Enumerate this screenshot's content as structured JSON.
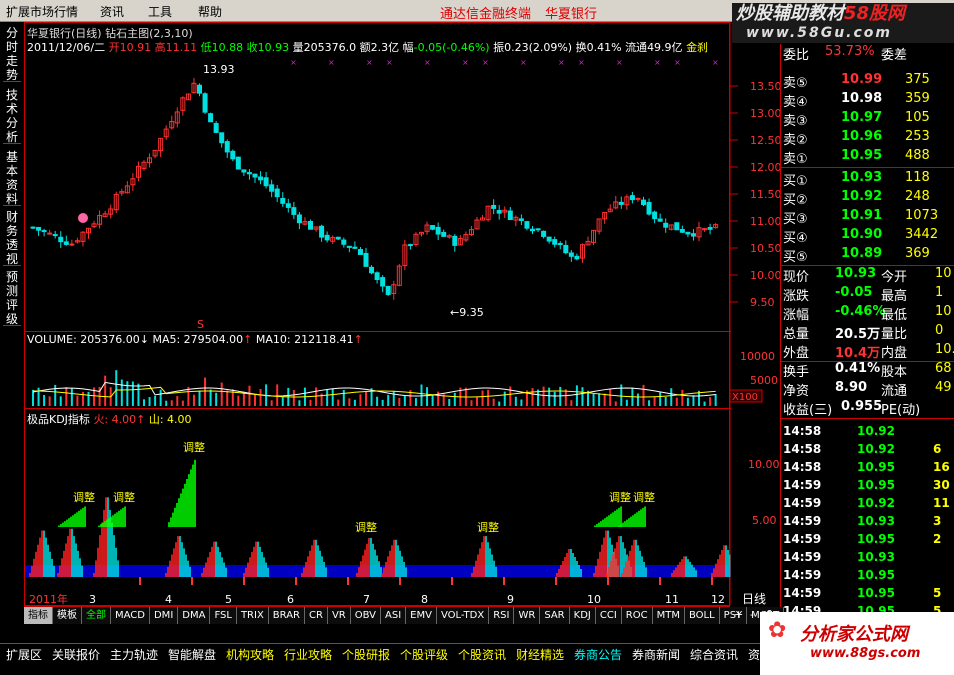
{
  "menu": {
    "items": [
      "扩展市场行情",
      "资讯",
      "工具",
      "帮助"
    ],
    "brand": "通达信金融终端",
    "stock": "华夏银行"
  },
  "watermark_top": {
    "line1a": "炒股辅助教材",
    "line1b": "58股网",
    "url": "www.58Gu.com"
  },
  "left_tabs": [
    "分时走势",
    "技术分析",
    "基本资料",
    "财务透视",
    "预测评级"
  ],
  "main_chart": {
    "title": "华夏银行(日线)  钻石主图(2,3,10)",
    "info": {
      "date": "2011/12/06/二",
      "open_label": "开",
      "open": "10.91",
      "high_label": "高",
      "high": "11.11",
      "low_label": "低",
      "low": "10.88",
      "close_label": "收",
      "close": "10.93",
      "vol_label": "量",
      "vol": "205376.0",
      "amt_label": "额",
      "amt": "2.3亿",
      "chg_label": "幅",
      "chg": "-0.05(-0.46%)",
      "amp_label": "振",
      "amp": "0.23(2.09%)",
      "turn_label": "换",
      "turn": "0.41%",
      "float_label": "流通",
      "float": "49.9亿",
      "extra": "金刹"
    },
    "price_axis": [
      "13.50",
      "13.00",
      "12.50",
      "12.00",
      "11.50",
      "11.00",
      "10.50",
      "10.00",
      "9.50"
    ],
    "high_mark": "13.93",
    "low_mark": "←9.35",
    "s_mark": "S"
  },
  "volume_panel": {
    "vol_label": "VOLUME: 205376.00",
    "ma5_label": "MA5: 279504.00",
    "ma10_label": "MA10: 212118.41",
    "axis": [
      "10000",
      "5000"
    ],
    "unit": "X100"
  },
  "kdj_panel": {
    "title": "极品KDJ指标",
    "fire_label": "火: 4.00",
    "mountain_label": "山: 4.00",
    "axis": [
      "10.00",
      "5.00"
    ],
    "annotation": "调整"
  },
  "x_axis": [
    "2011年",
    "3",
    "4",
    "5",
    "6",
    "7",
    "8",
    "9",
    "10",
    "11",
    "12"
  ],
  "period": "日线",
  "bottom_tabs": [
    "指标",
    "模板",
    "全部",
    "MACD",
    "DMI",
    "DMA",
    "FSL",
    "TRIX",
    "BRAR",
    "CR",
    "VR",
    "OBV",
    "ASI",
    "EMV",
    "VOL-TDX",
    "RSI",
    "WR",
    "SAR",
    "KDJ",
    "CCI",
    "ROC",
    "MTM",
    "BOLL",
    "PSY",
    "MCST"
  ],
  "status_tabs": [
    "扩展区",
    "关联报价",
    "主力轨迹",
    "智能解盘",
    "机构攻略",
    "行业攻略",
    "个股研报",
    "个股评级",
    "个股资讯",
    "财经精选",
    "券商公告",
    "券商新闻",
    "综合资讯",
    "资讯"
  ],
  "order_book": {
    "header": {
      "l": "委比",
      "v": "53.73%",
      "r": "委差"
    },
    "asks": [
      {
        "l": "卖⑤",
        "p": "10.99",
        "v": "375"
      },
      {
        "l": "卖④",
        "p": "10.98",
        "v": "359"
      },
      {
        "l": "卖③",
        "p": "10.97",
        "v": "105"
      },
      {
        "l": "卖②",
        "p": "10.96",
        "v": "253"
      },
      {
        "l": "卖①",
        "p": "10.95",
        "v": "488"
      }
    ],
    "bids": [
      {
        "l": "买①",
        "p": "10.93",
        "v": "118"
      },
      {
        "l": "买②",
        "p": "10.92",
        "v": "248"
      },
      {
        "l": "买③",
        "p": "10.91",
        "v": "1073"
      },
      {
        "l": "买④",
        "p": "10.90",
        "v": "3442"
      },
      {
        "l": "买⑤",
        "p": "10.89",
        "v": "369"
      }
    ]
  },
  "quote": [
    {
      "l1": "现价",
      "v1": "10.93",
      "l2": "今开",
      "v2": "10"
    },
    {
      "l1": "涨跌",
      "v1": "-0.05",
      "l2": "最高",
      "v2": "1"
    },
    {
      "l1": "涨幅",
      "v1": "-0.46%",
      "l2": "最低",
      "v2": "10"
    },
    {
      "l1": "总量",
      "v1": "20.5万",
      "l2": "量比",
      "v2": "0"
    },
    {
      "l1": "外盘",
      "v1": "10.4万",
      "l2": "内盘",
      "v2": "10."
    },
    {
      "l1": "换手",
      "v1": "0.41%",
      "l2": "股本",
      "v2": "68"
    },
    {
      "l1": "净资",
      "v1": "8.90",
      "l2": "流通",
      "v2": "49"
    },
    {
      "l1": "收益(三)",
      "v1": "0.955",
      "l2": "PE(动)",
      "v2": ""
    }
  ],
  "ticks": [
    {
      "t": "14:58",
      "p": "10.92",
      "v": ""
    },
    {
      "t": "14:58",
      "p": "10.92",
      "v": "6"
    },
    {
      "t": "14:58",
      "p": "10.95",
      "v": "16"
    },
    {
      "t": "14:59",
      "p": "10.95",
      "v": "30"
    },
    {
      "t": "14:59",
      "p": "10.92",
      "v": "11"
    },
    {
      "t": "14:59",
      "p": "10.93",
      "v": "3"
    },
    {
      "t": "14:59",
      "p": "10.95",
      "v": "2"
    },
    {
      "t": "14:59",
      "p": "10.93",
      "v": ""
    },
    {
      "t": "14:59",
      "p": "10.95",
      "v": ""
    },
    {
      "t": "14:59",
      "p": "10.95",
      "v": "5"
    },
    {
      "t": "14:59",
      "p": "10.95",
      "v": "5"
    }
  ],
  "watermark_bottom": {
    "title": "分析家公式网",
    "url": "www.88gs.com"
  },
  "colors": {
    "up": "#ff3030",
    "down": "#00e0e0",
    "frame": "#c00000",
    "green": "#00ff00",
    "yellow": "#ffff00"
  }
}
